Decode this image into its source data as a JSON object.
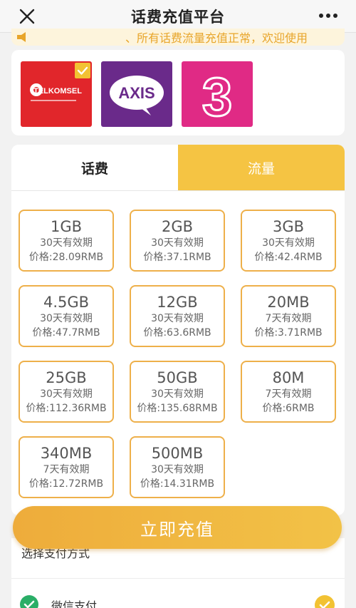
{
  "header": {
    "title": "话费充值平台",
    "close_icon": "close-icon",
    "more_icon": "more-icon"
  },
  "notice": {
    "text": "、所有话费流量充值正常，欢迎使用"
  },
  "operators": [
    {
      "name": "TELKOMSEL",
      "selected": true,
      "color": "#e1262b"
    },
    {
      "name": "AXIS",
      "selected": false,
      "color": "#6a2a8a"
    },
    {
      "name": "3",
      "selected": false,
      "color": "#e02a85"
    }
  ],
  "tabs": [
    {
      "label": "话费",
      "active": false
    },
    {
      "label": "流量",
      "active": true
    }
  ],
  "plans": [
    {
      "size": "1GB",
      "validity": "30天有效期",
      "price": "价格:28.09RMB"
    },
    {
      "size": "2GB",
      "validity": "30天有效期",
      "price": "价格:37.1RMB"
    },
    {
      "size": "3GB",
      "validity": "30天有效期",
      "price": "价格:42.4RMB"
    },
    {
      "size": "4.5GB",
      "validity": "30天有效期",
      "price": "价格:47.7RMB"
    },
    {
      "size": "12GB",
      "validity": "30天有效期",
      "price": "价格:63.6RMB"
    },
    {
      "size": "20MB",
      "validity": "7天有效期",
      "price": "价格:3.71RMB"
    },
    {
      "size": "25GB",
      "validity": "30天有效期",
      "price": "价格:112.36RMB"
    },
    {
      "size": "50GB",
      "validity": "30天有效期",
      "price": "价格:135.68RMB"
    },
    {
      "size": "80M",
      "validity": "7天有效期",
      "price": "价格:6RMB"
    },
    {
      "size": "340MB",
      "validity": "7天有效期",
      "price": "价格:12.72RMB"
    },
    {
      "size": "500MB",
      "validity": "30天有效期",
      "price": "价格:14.31RMB"
    }
  ],
  "recharge_button": {
    "label": "立即充值"
  },
  "payment": {
    "section_label": "选择支付方式",
    "wechat_label": "微信支付",
    "wechat_selected": true
  },
  "colors": {
    "accent": "#f5c443",
    "plan_border": "#eeb04a",
    "wechat_green": "#2aae67"
  }
}
